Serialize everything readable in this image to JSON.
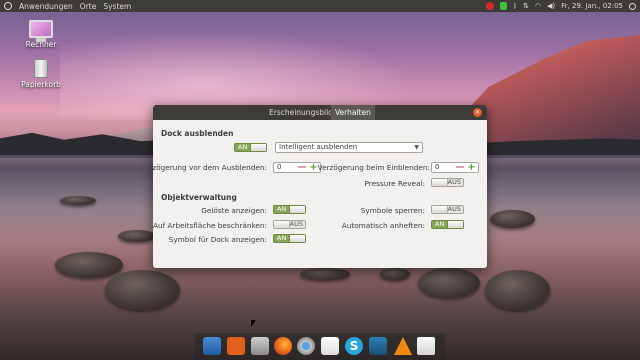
{
  "top_panel": {
    "menu": [
      "Anwendungen",
      "Orte",
      "System"
    ],
    "clock": "Fr, 29. Jan., 02:05"
  },
  "desktop": {
    "icons": [
      {
        "label": "Rechner",
        "icon": "computer-icon"
      },
      {
        "label": "Papierkorb",
        "icon": "trash-icon"
      }
    ]
  },
  "dialog": {
    "tabs": [
      "Erscheinungsbild",
      "Verhalten"
    ],
    "active_tab": "Verhalten",
    "dock_section": {
      "title": "Dock ausblenden",
      "hide_toggle": "AN",
      "hide_mode": "Intelligent ausblenden",
      "delay_hide_label": "Verzögerung vor dem Ausblenden:",
      "delay_hide_value": "0",
      "delay_show_label": "Verzögerung beim Einblenden:",
      "delay_show_value": "0",
      "pressure_label": "Pressure Reveal:",
      "pressure_toggle": "AUS"
    },
    "objects_section": {
      "title": "Objektverwaltung",
      "unpinned_label": "Gelöste anzeigen:",
      "unpinned_toggle": "AN",
      "restrict_label": "Auf Arbeitsfläche beschränken:",
      "restrict_toggle": "AUS",
      "dock_icon_label": "Symbol für Dock anzeigen:",
      "dock_icon_toggle": "AN",
      "lock_label": "Symbole sperren:",
      "lock_toggle": "AUS",
      "autopin_label": "Automatisch anheften:",
      "autopin_toggle": "AN"
    }
  },
  "dock_apps": [
    "files-icon",
    "software-center-icon",
    "file-manager-icon",
    "firefox-icon",
    "chromium-icon",
    "mail-icon",
    "skype-icon",
    "kodi-icon",
    "vlc-icon",
    "settings-icon"
  ],
  "colors": {
    "panel": "#3c3b37",
    "toggle_on": "#87a556",
    "close": "#e05a2b"
  }
}
